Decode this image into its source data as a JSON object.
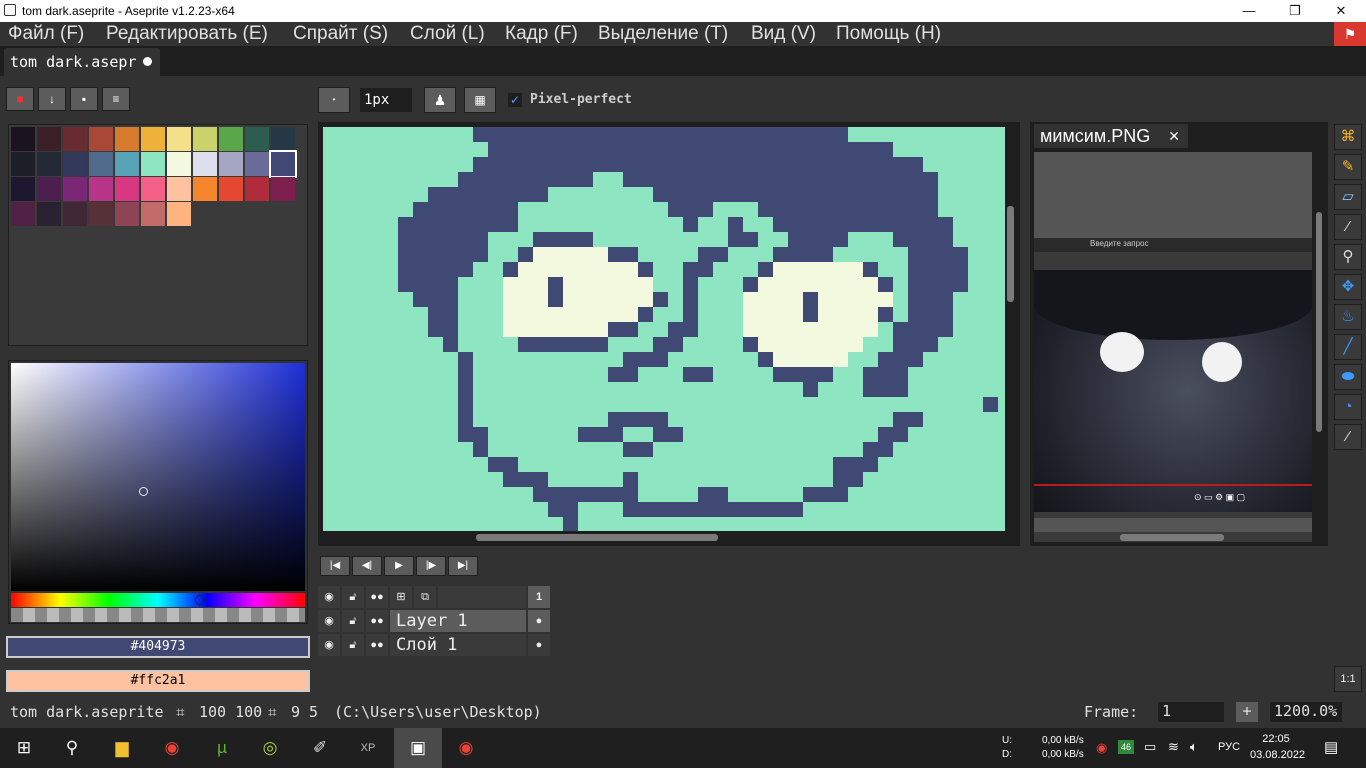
{
  "window": {
    "title": "tom dark.aseprite - Aseprite v1.2.23-x64",
    "minimize": "—",
    "maximize": "❐",
    "close": "✕"
  },
  "menu": {
    "items": [
      "Файл (F)",
      "Редактировать (E)",
      "Спрайт (S)",
      "Слой (L)",
      "Кадр (F)",
      "Выделение (T)",
      "Вид (V)",
      "Помощь (H)"
    ]
  },
  "tab": {
    "label": "tom dark.asepr"
  },
  "toolbar": {
    "brush_size": "1px",
    "pixel_perfect_label": "Pixel-perfect",
    "pixel_perfect_checked": true
  },
  "palette": {
    "colors": [
      "#1b1420",
      "#3b2127",
      "#6a2b30",
      "#a94836",
      "#d67a2b",
      "#eeb13a",
      "#f4e08a",
      "#cad36b",
      "#5aa64b",
      "#2c5d4f",
      "#243846",
      "#1c2026",
      "#232a35",
      "#33395a",
      "#4f6a8a",
      "#58a3b5",
      "#8ee5c1",
      "#f2f9de",
      "#dde0ec",
      "#a4a6c4",
      "#6b6b9a",
      "#404973",
      "#1d1830",
      "#4c1f4f",
      "#7b2677",
      "#b73487",
      "#d83782",
      "#f45f88",
      "#ffc2a1",
      "#f5862b",
      "#e64731",
      "#b02b3b",
      "#7e1f4f",
      "#512045",
      "#2a2230",
      "#3f2735",
      "#583038",
      "#8d4555",
      "#c06a6a",
      "#ffb380"
    ],
    "selected_index": 21
  },
  "colors": {
    "foreground": "#404973",
    "background": "#ffc2a1",
    "canvas_bg": "#8ee5c1",
    "pixel_dark": "#404973",
    "pixel_light": "#f2f9de"
  },
  "preview": {
    "title": "мимсим.PNG",
    "search_placeholder": "Введите запрос"
  },
  "timeline": {
    "frame_header": "1",
    "layers": [
      {
        "name": "Layer 1"
      },
      {
        "name": "Слой 1"
      }
    ]
  },
  "status": {
    "filename": "tom dark.aseprite",
    "size": "100 100",
    "position": "9 5",
    "path": "(C:\\Users\\user\\Desktop)",
    "frame_label": "Frame:",
    "frame_value": "1",
    "add": "+",
    "zoom": "1200.0%"
  },
  "taskbar": {
    "net_up_label": "U:",
    "net_down_label": "D:",
    "net_up": "0,00 kB/s",
    "net_down": "0,00 kB/s",
    "badge": "46",
    "lang": "РУС",
    "time": "22:05",
    "date": "03.08.2022"
  },
  "sprite_rows": [
    "..........XXXXXXXXXXXXXXXXXXXXXXXXX...........",
    "...........XXXXXXXXXXXXXXXXXXXXXXXXXXX.........",
    "..........XXXXXXXXXXXXXXXXXXXXXXXXXXXXXX.......",
    ".........XXXXXXXXX..XXXXXXXXXXXXXXXXXXXXX......",
    ".......XXXXXXXX.......XXXXXXXXXXXXXXXXXXX......",
    "......XXXXXXX..........XXX...XXXXXXXXXXXX.....",
    ".....XXXXXXXX...........X..X..XXXXXXXXXXXX....",
    ".....XXXXXX...XXXX.........XX..XXXX...XXXX....",
    ".....XXXXXX..XOOOOOXX....XX...XXXX.....XXXX...",
    ".....XXXXX..XOOOOOOOOX..XX...XOOOOOOX..XXXX...",
    ".....XXXX...OOOXOOOOOO..X...XOOOOOOOOX.XXXX...",
    "......XXX...OOOXOOOOOOX.X...OOOOXOOOOO.XXX....",
    ".......XX...OOOOOOOOOX..X...OOOOXOOOOX.XXX....",
    ".......XX...OOOOOOOXX..XX...OOOOOOOOO.XXXX....",
    "........X....XXXXXX...XX....XOOOOOOO..XXX.....",
    ".........X..........XXX......XOOOOO..XXX......",
    ".........X.........XX...XX....XXXX..XXX.......",
    ".........X......................X...XXX.......",
    ".........X..................................X.",
    ".........X.........XXXX...............XX......",
    ".........XX......XXX..XX.............XX.......",
    "..........X.........XX..............XX........",
    "...........XX.....................XXX.........",
    "............XXX.....X.............XX..........",
    "..............XXXXXXX....XX.....XXX...........",
    "...............XX...XXXXXXXXXXXX..............",
    "................X..............................."
  ]
}
